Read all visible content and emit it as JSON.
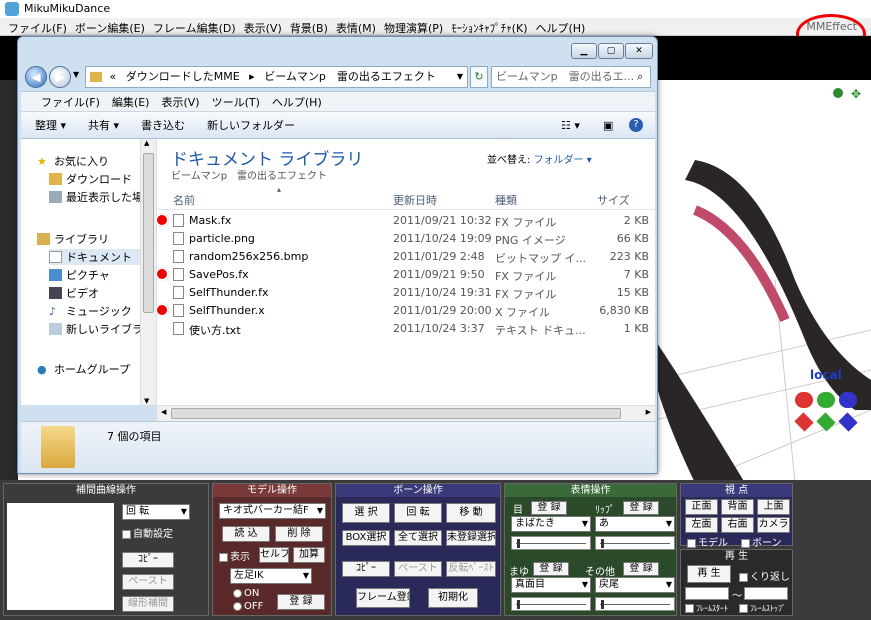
{
  "mmd": {
    "title": "MikuMikuDance",
    "menu": [
      "ファイル(F)",
      "ボーン編集(E)",
      "フレーム編集(D)",
      "表示(V)",
      "背景(B)",
      "表情(M)",
      "物理演算(P)",
      "ﾓｰｼｮﾝｷｬﾌﾟﾁｬ(K)",
      "ヘルプ(H)"
    ],
    "mmeffect": "MMEffect",
    "viewport_local": "local",
    "panels": {
      "interp": {
        "title": "補間曲線操作",
        "rotate": "回 転",
        "auto": "自動設定",
        "copy": "ｺﾋﾟｰ",
        "paste": "ペースト",
        "linear": "線形補間"
      },
      "model": {
        "title": "モデル操作",
        "model_select": "キオ式バーカー結F",
        "load": "読 込",
        "delete": "削 除",
        "display": "表示",
        "self_shadow": "セルフ影",
        "add": "加算",
        "bone_select": "左足IK",
        "on": "ON",
        "off": "OFF",
        "register": "登 録"
      },
      "bone": {
        "title": "ボーン操作",
        "select": "選 択",
        "rotate": "回 転",
        "move": "移 動",
        "box_select": "BOX選択",
        "select_all": "全て選択",
        "unreg_select": "未登録選択",
        "copy": "ｺﾋﾟｰ",
        "paste": "ペースト",
        "invert_paste": "反転ﾍﾟｰｽﾄ",
        "frame_reg": "フレーム登録",
        "init": "初期化"
      },
      "face": {
        "title": "表情操作",
        "eye": "目",
        "lip": "ﾘｯﾌﾟ",
        "brow": "まゆ",
        "other": "その他",
        "register": "登 録",
        "eye_sel": "まばたき",
        "lip_sel": "あ",
        "brow_sel": "真面目",
        "other_sel": "戻尾"
      },
      "view": {
        "title": "視 点",
        "front": "正面",
        "back": "背面",
        "top": "上面",
        "left": "左面",
        "right": "右面",
        "camera": "カメラ",
        "model": "モデル",
        "bone": "ボーン"
      },
      "play": {
        "title": "再 生",
        "play": "再 生",
        "loop": "くり返し",
        "tilde": "～",
        "frame_start": "ﾌﾚｰﾑｽﾀｰﾄ",
        "frame_stop": "ﾌﾚｰﾑｽﾄｯﾌﾟ"
      }
    }
  },
  "explorer": {
    "address": [
      "«",
      "ダウンロードしたMME",
      "ビームマンp　雷の出るエフェクト"
    ],
    "search_placeholder": "ビームマンp　雷の出るエ...",
    "menu": [
      "ファイル(F)",
      "編集(E)",
      "表示(V)",
      "ツール(T)",
      "ヘルプ(H)"
    ],
    "commands": [
      "整理 ▾",
      "共有 ▾",
      "書き込む",
      "新しいフォルダー"
    ],
    "nav": {
      "favorites": "お気に入り",
      "downloads": "ダウンロード",
      "recent": "最近表示した場",
      "library": "ライブラリ",
      "documents": "ドキュメント",
      "pictures": "ピクチャ",
      "videos": "ビデオ",
      "music": "ミュージック",
      "newlib": "新しいライブラ",
      "homegroup": "ホームグループ"
    },
    "library_title": "ドキュメント ライブラリ",
    "library_sub": "ビームマンp　雷の出るエフェクト",
    "arrange_label": "並べ替え:",
    "arrange_value": "フォルダー ▾",
    "columns": [
      "名前",
      "更新日時",
      "種類",
      "サイズ"
    ],
    "files": [
      {
        "name": "Mask.fx",
        "date": "2011/09/21 10:32",
        "type": "FX ファイル",
        "size": "2 KB",
        "marked": true
      },
      {
        "name": "particle.png",
        "date": "2011/10/24 19:09",
        "type": "PNG イメージ",
        "size": "66 KB",
        "marked": false
      },
      {
        "name": "random256x256.bmp",
        "date": "2011/01/29 2:48",
        "type": "ビットマップ イ...",
        "size": "223 KB",
        "marked": false
      },
      {
        "name": "SavePos.fx",
        "date": "2011/09/21 9:50",
        "type": "FX ファイル",
        "size": "7 KB",
        "marked": true
      },
      {
        "name": "SelfThunder.fx",
        "date": "2011/10/24 19:31",
        "type": "FX ファイル",
        "size": "15 KB",
        "marked": false
      },
      {
        "name": "SelfThunder.x",
        "date": "2011/01/29 20:00",
        "type": "X ファイル",
        "size": "6,830 KB",
        "marked": true
      },
      {
        "name": "使い方.txt",
        "date": "2011/10/24 3:37",
        "type": "テキスト ドキュ...",
        "size": "1 KB",
        "marked": false
      }
    ],
    "status": "7 個の項目"
  }
}
